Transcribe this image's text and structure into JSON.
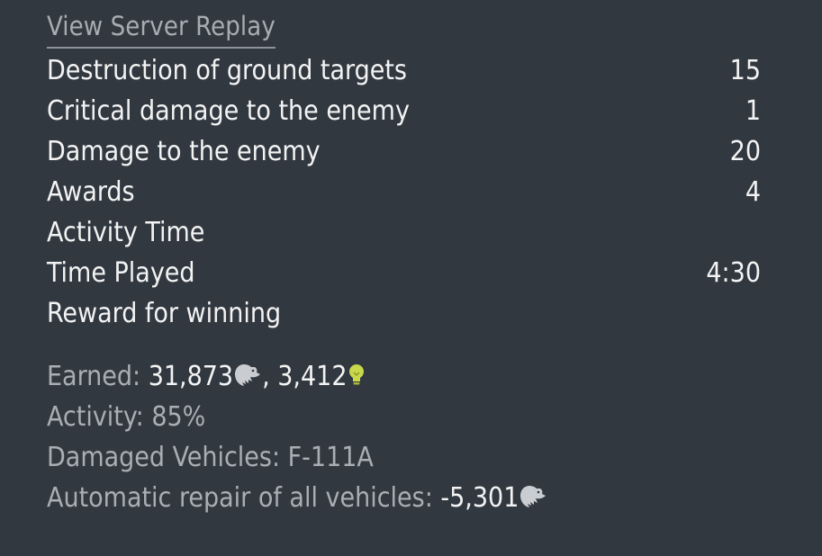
{
  "replay_link": "View Server Replay",
  "stats": [
    {
      "label": "Destruction of ground targets",
      "value": "15"
    },
    {
      "label": "Critical damage to the enemy",
      "value": "1"
    },
    {
      "label": "Damage to the enemy",
      "value": "20"
    },
    {
      "label": "Awards",
      "value": "4"
    },
    {
      "label": "Activity Time",
      "value": ""
    },
    {
      "label": "Time Played",
      "value": "4:30"
    },
    {
      "label": "Reward for winning",
      "value": ""
    }
  ],
  "summary": {
    "earned_label": "Earned: ",
    "earned_silver": "31,873",
    "earned_sep": ", ",
    "earned_rp": "3,412",
    "activity_label": "Activity: 85%",
    "damaged_label": "Damaged Vehicles: F-111A",
    "repair_label": "Automatic repair of all vehicles: ",
    "repair_value": "-5,301"
  },
  "icons": {
    "silver": "silver-lions-icon",
    "research": "research-points-icon"
  },
  "colors": {
    "background": "#313840",
    "text": "#f3f3f3",
    "muted": "#a9aeb3",
    "research_icon": "#c8d84a"
  }
}
